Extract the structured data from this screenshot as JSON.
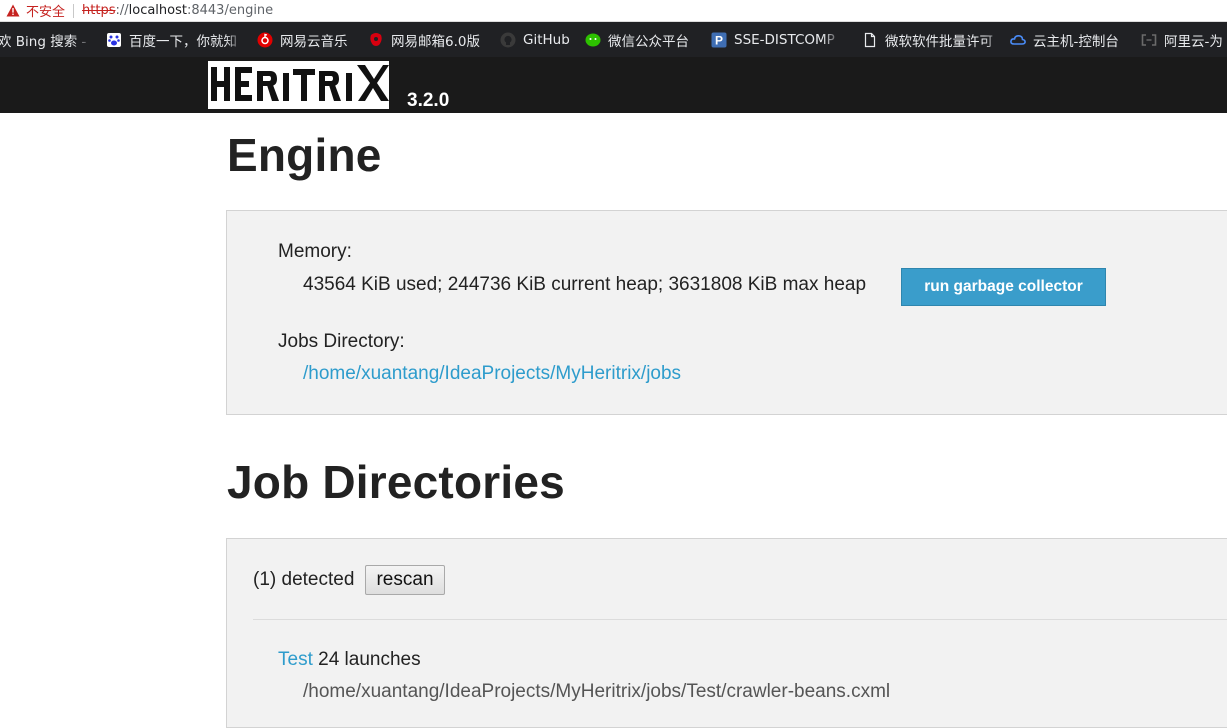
{
  "browser": {
    "security_label": "不安全",
    "url_scheme": "https",
    "url_sep": "://",
    "url_host": "localhost",
    "url_path": ":8443/engine"
  },
  "bookmarks": [
    {
      "label": "欢 Bing 搜索 -",
      "icon": "none"
    },
    {
      "label": "百度一下，你就知",
      "icon": "baidu-paw-icon"
    },
    {
      "label": "网易云音乐",
      "icon": "netease-music-icon"
    },
    {
      "label": "网易邮箱6.0版",
      "icon": "netease-mail-icon"
    },
    {
      "label": "GitHub",
      "icon": "github-icon"
    },
    {
      "label": "微信公众平台",
      "icon": "wechat-icon"
    },
    {
      "label": "SSE-DISTCOMP",
      "icon": "p-letter-icon"
    },
    {
      "label": "微软软件批量许可",
      "icon": "page-icon"
    },
    {
      "label": "云主机-控制台",
      "icon": "cloud-icon"
    },
    {
      "label": "阿里云-为",
      "icon": "aliyun-icon"
    }
  ],
  "header": {
    "logo_text": "HERITRIX",
    "version": "3.2.0"
  },
  "engine": {
    "title": "Engine",
    "memory_label": "Memory:",
    "memory_value": "43564 KiB used; 244736 KiB current heap; 3631808 KiB max heap",
    "gc_button": "run garbage collector",
    "jobs_dir_label": "Jobs Directory:",
    "jobs_dir_path": "/home/xuantang/IdeaProjects/MyHeritrix/jobs"
  },
  "job_directories": {
    "title": "Job Directories",
    "detected": "(1) detected",
    "rescan_button": "rescan",
    "jobs": [
      {
        "name": "Test",
        "launches": "24 launches",
        "path": "/home/xuantang/IdeaProjects/MyHeritrix/jobs/Test/crawler-beans.cxml"
      }
    ]
  },
  "colors": {
    "link": "#2e9ccc",
    "gc_button_bg": "#3a9dcb",
    "header_bg": "#1a1a1a",
    "panel_bg": "#f2f2f2",
    "bookmarks_bg": "#202124",
    "insecure_red": "#c5221f"
  }
}
